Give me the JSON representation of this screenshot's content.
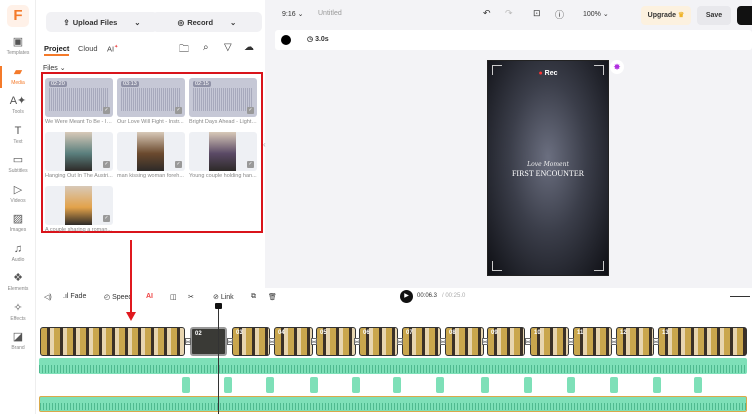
{
  "sidebar": {
    "logo": "F",
    "items": [
      {
        "label": "Templates",
        "icon": "template-icon"
      },
      {
        "label": "Media",
        "icon": "media-icon",
        "active": true
      },
      {
        "label": "Tools",
        "icon": "ai-tools-icon"
      },
      {
        "label": "Text",
        "icon": "text-icon"
      },
      {
        "label": "Subtitles",
        "icon": "subtitles-icon"
      },
      {
        "label": "Videos",
        "icon": "video-icon"
      },
      {
        "label": "Images",
        "icon": "image-icon"
      },
      {
        "label": "Audio",
        "icon": "audio-icon"
      },
      {
        "label": "Elements",
        "icon": "elements-icon"
      },
      {
        "label": "Effects",
        "icon": "effects-icon"
      },
      {
        "label": "Brand",
        "icon": "brand-icon"
      }
    ]
  },
  "panel": {
    "upload": "Upload Files",
    "record": "Record",
    "tabs": [
      "Project",
      "Cloud",
      "AI"
    ],
    "files_label": "Files",
    "files": [
      {
        "type": "audio",
        "duration": "02:20",
        "name": "We Were Meant To Be - In..."
      },
      {
        "type": "audio",
        "duration": "03:13",
        "name": "Our Love Will Fight - Instr..."
      },
      {
        "type": "audio",
        "duration": "02:15",
        "name": "Bright Days Ahead - Light ..."
      },
      {
        "type": "image",
        "name": "Hanging Out In The Austri...",
        "color": "#5a7f7d"
      },
      {
        "type": "image",
        "name": "man kissing woman foreh...",
        "color": "#6b4a2e"
      },
      {
        "type": "image",
        "name": "Young couple holding han...",
        "color": "#5b4a66"
      },
      {
        "type": "image",
        "name": "A couple sharing a roman...",
        "color": "#e2a24a"
      }
    ]
  },
  "topbar": {
    "ratio": "9:16",
    "title": "Untitled",
    "zoom": "100%",
    "upgrade": "Upgrade",
    "save": "Save"
  },
  "props": {
    "duration": "3.0s",
    "color": "#000000"
  },
  "preview": {
    "rec": "Rec",
    "subtitle": "Love Moment",
    "title": "FIRST ENCOUNTER"
  },
  "timeline": {
    "tools": {
      "fade": "Fade",
      "speed": "Speed",
      "link": "Link"
    },
    "current": "00:06.3",
    "total": "/ 00:25.0",
    "clips": [
      "",
      "02",
      "03",
      "04",
      "05",
      "06",
      "07",
      "08",
      "09",
      "10",
      "11",
      "12",
      "13"
    ]
  },
  "accent": "#f47a2a",
  "highlight": "#d9141b"
}
